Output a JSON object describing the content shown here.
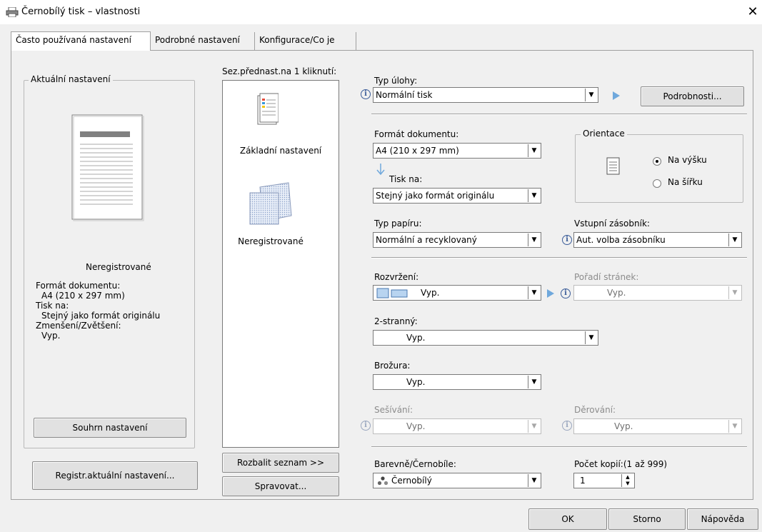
{
  "window": {
    "title": "Černobílý tisk – vlastnosti",
    "close_glyph": "✕"
  },
  "tabs": [
    {
      "label": "Často používaná nastavení"
    },
    {
      "label": "Podrobné nastavení"
    },
    {
      "label": "Konfigurace/Co je"
    }
  ],
  "current": {
    "group_label": "Aktuální nastavení",
    "preset_name": "Neregistrované",
    "summary_lines": [
      "Formát dokumentu:",
      "A4 (210 x 297 mm)",
      "Tisk na:",
      "Stejný jako formát originálu",
      "Zmenšení/Zvětšení:",
      "Vyp."
    ],
    "summary_button": "Souhrn nastavení",
    "register_button": "Registr.aktuální nastavení..."
  },
  "presets": {
    "label": "Sez.přednast.na 1 kliknutí:",
    "items": [
      {
        "label": "Základní nastavení"
      },
      {
        "label": "Neregistrované"
      }
    ],
    "expand_button": "Rozbalit seznam >>",
    "manage_button": "Spravovat..."
  },
  "job": {
    "label": "Typ úlohy:",
    "value": "Normální tisk",
    "details_button": "Podrobnosti..."
  },
  "document_size": {
    "label": "Formát dokumentu:",
    "value": "A4 (210 x 297 mm)"
  },
  "print_on": {
    "label": "Tisk na:",
    "value": "Stejný jako formát originálu"
  },
  "orientation": {
    "label": "Orientace",
    "portrait": "Na výšku",
    "landscape": "Na šířku"
  },
  "paper_type": {
    "label": "Typ papíru:",
    "value": "Normální a recyklovaný"
  },
  "input_tray": {
    "label": "Vstupní zásobník:",
    "value": "Aut. volba zásobníku"
  },
  "layout": {
    "label": "Rozvržení:",
    "value": "Vyp."
  },
  "page_order": {
    "label": "Pořadí stránek:",
    "value": "Vyp."
  },
  "duplex": {
    "label": "2-stranný:",
    "value": "Vyp."
  },
  "booklet": {
    "label": "Brožura:",
    "value": "Vyp."
  },
  "staple": {
    "label": "Sešívání:",
    "value": "Vyp."
  },
  "punch": {
    "label": "Děrování:",
    "value": "Vyp."
  },
  "color": {
    "label": "Barevně/Černobíle:",
    "value": "Černobílý"
  },
  "copies": {
    "label": "Počet kopií:(1 až 999)",
    "value": "1"
  },
  "dialog_buttons": {
    "ok": "OK",
    "cancel": "Storno",
    "help": "Nápověda"
  },
  "colors": {
    "accent_arrow": "#6fa8dc",
    "info_icon": "#3a5c99"
  }
}
